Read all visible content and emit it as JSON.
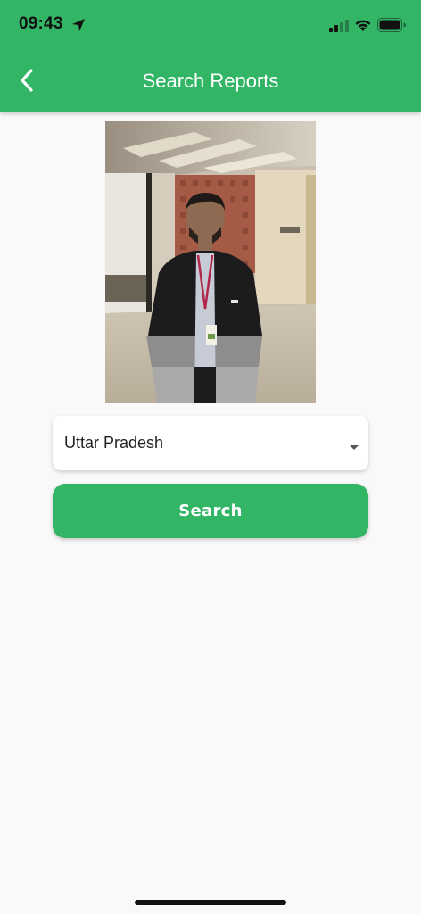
{
  "status_bar": {
    "time": "09:43",
    "icons": [
      "location-arrow-icon",
      "cellular-signal-icon",
      "wifi-icon",
      "battery-icon"
    ]
  },
  "header": {
    "title": "Search Reports",
    "back_icon": "chevron-left-icon",
    "background_color": "#33b566"
  },
  "photo": {
    "description_icon": "person-photo"
  },
  "state_select": {
    "selected_value": "Uttar Pradesh",
    "icon": "caret-down-icon"
  },
  "search_button": {
    "label": "Search",
    "color": "#33b566"
  }
}
